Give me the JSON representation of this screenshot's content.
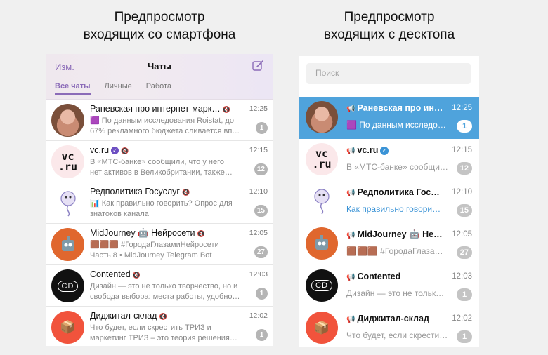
{
  "headings": {
    "mobile": [
      "Предпросмотр",
      "входящих со смартфона"
    ],
    "desktop": [
      "Предпросмотр",
      "входящих с десктопа"
    ]
  },
  "mobile": {
    "edit": "Изм.",
    "title": "Чаты",
    "tabs": [
      "Все чаты",
      "Личные",
      "Работа"
    ],
    "chats": [
      {
        "name": "Раневская про интернет-марк…",
        "time": "12:25",
        "line1": "🟪 По данным исследования Roistat, до",
        "line2": "67% рекламного бюджета сливается вп…",
        "badge": "1"
      },
      {
        "name": "vc.ru",
        "time": "12:15",
        "line1": "В «МТС-банке» сообщили, что у него",
        "line2": "нет активов в Великобритании, также…",
        "badge": "12"
      },
      {
        "name": "Редполитика Госуслуг",
        "time": "12:10",
        "line1": "📊 Как правильно говорить? Опрос для",
        "line2": "знатоков канала",
        "badge": "15"
      },
      {
        "name": "MidJourney 🤖 Нейросети",
        "time": "12:05",
        "line1": "🟫🟫🟫 #ГородаГлазамиНейросети",
        "line2": "Часть 8 • MidJourney Telegram Bot",
        "badge": "27"
      },
      {
        "name": "Contented",
        "time": "12:03",
        "line1": "Дизайн — это не только творчество, но и",
        "line2": "свобода выбора: места работы, удобно…",
        "badge": "1"
      },
      {
        "name": "Диджитал-склад",
        "time": "12:02",
        "line1": "Что будет, если скрестить ТРИЗ и",
        "line2": "маркетинг ТРИЗ – это теория решения…",
        "badge": "1"
      }
    ]
  },
  "desktop": {
    "search_placeholder": "Поиск",
    "chats": [
      {
        "name": "Раневская про ин…",
        "time": "12:25",
        "msg": "🟪 По данным исследо…",
        "badge": "1"
      },
      {
        "name": "vc.ru",
        "time": "12:15",
        "msg": "В «МТС-банке» сообщи…",
        "badge": "12"
      },
      {
        "name": "Редполитика Гос…",
        "time": "12:10",
        "msg": "Как правильно говори…",
        "badge": "15"
      },
      {
        "name": "MidJourney 🤖 Не…",
        "time": "12:05",
        "msg": "🟫🟫🟫 #ГородаГлаза…",
        "badge": "27"
      },
      {
        "name": "Contented",
        "time": "12:03",
        "msg": "Дизайн — это не тольк…",
        "badge": "1"
      },
      {
        "name": "Диджитал-склад",
        "time": "12:02",
        "msg": "Что будет, если скрести…",
        "badge": "1"
      }
    ]
  },
  "avatars": {
    "vc_top": "vc",
    "vc_bottom": ".ru",
    "contented": "CD",
    "box": "📦"
  },
  "colors": {
    "accent_mobile": "#8b6bb8",
    "accent_desktop": "#4fa3dc",
    "badge": "#b5b5b5"
  }
}
